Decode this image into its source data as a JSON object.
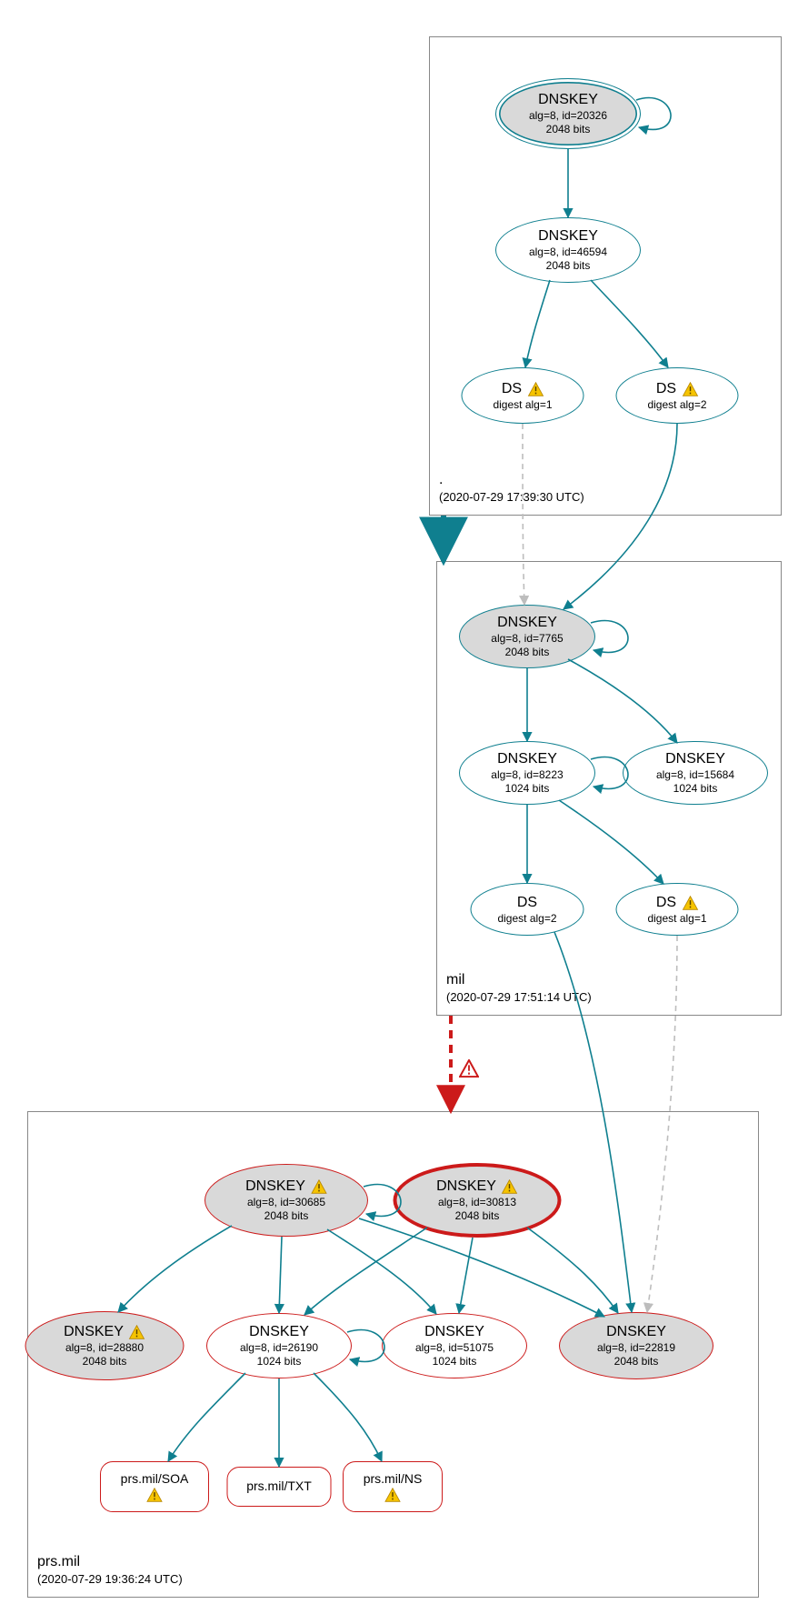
{
  "colors": {
    "teal": "#0f7f8f",
    "red": "#cc1a1a",
    "grey_fill": "#d9d9d9",
    "light_grey": "#bdbdbd"
  },
  "zones": {
    "root": {
      "name": ".",
      "timestamp": "(2020-07-29 17:39:30 UTC)"
    },
    "mil": {
      "name": "mil",
      "timestamp": "(2020-07-29 17:51:14 UTC)"
    },
    "prsmil": {
      "name": "prs.mil",
      "timestamp": "(2020-07-29 19:36:24 UTC)"
    }
  },
  "nodes": {
    "root_ksk": {
      "title": "DNSKEY",
      "line2": "alg=8, id=20326",
      "line3": "2048 bits",
      "warn": false
    },
    "root_zsk": {
      "title": "DNSKEY",
      "line2": "alg=8, id=46594",
      "line3": "2048 bits",
      "warn": false
    },
    "root_ds1": {
      "title": "DS",
      "line2": "digest alg=1",
      "warn": true
    },
    "root_ds2": {
      "title": "DS",
      "line2": "digest alg=2",
      "warn": true
    },
    "mil_ksk": {
      "title": "DNSKEY",
      "line2": "alg=8, id=7765",
      "line3": "2048 bits",
      "warn": false
    },
    "mil_zsk": {
      "title": "DNSKEY",
      "line2": "alg=8, id=8223",
      "line3": "1024 bits",
      "warn": false
    },
    "mil_dnskey2": {
      "title": "DNSKEY",
      "line2": "alg=8, id=15684",
      "line3": "1024 bits",
      "warn": false
    },
    "mil_ds2": {
      "title": "DS",
      "line2": "digest alg=2",
      "warn": false
    },
    "mil_ds1": {
      "title": "DS",
      "line2": "digest alg=1",
      "warn": true
    },
    "prs_ksk1": {
      "title": "DNSKEY",
      "line2": "alg=8, id=30685",
      "line3": "2048 bits",
      "warn": true
    },
    "prs_ksk2": {
      "title": "DNSKEY",
      "line2": "alg=8, id=30813",
      "line3": "2048 bits",
      "warn": true
    },
    "prs_k28880": {
      "title": "DNSKEY",
      "line2": "alg=8, id=28880",
      "line3": "2048 bits",
      "warn": true
    },
    "prs_k26190": {
      "title": "DNSKEY",
      "line2": "alg=8, id=26190",
      "line3": "1024 bits",
      "warn": false
    },
    "prs_k51075": {
      "title": "DNSKEY",
      "line2": "alg=8, id=51075",
      "line3": "1024 bits",
      "warn": false
    },
    "prs_k22819": {
      "title": "DNSKEY",
      "line2": "alg=8, id=22819",
      "line3": "2048 bits",
      "warn": false
    },
    "rr_soa": {
      "title": "prs.mil/SOA",
      "warn": true
    },
    "rr_txt": {
      "title": "prs.mil/TXT",
      "warn": false
    },
    "rr_ns": {
      "title": "prs.mil/NS",
      "warn": true
    }
  }
}
